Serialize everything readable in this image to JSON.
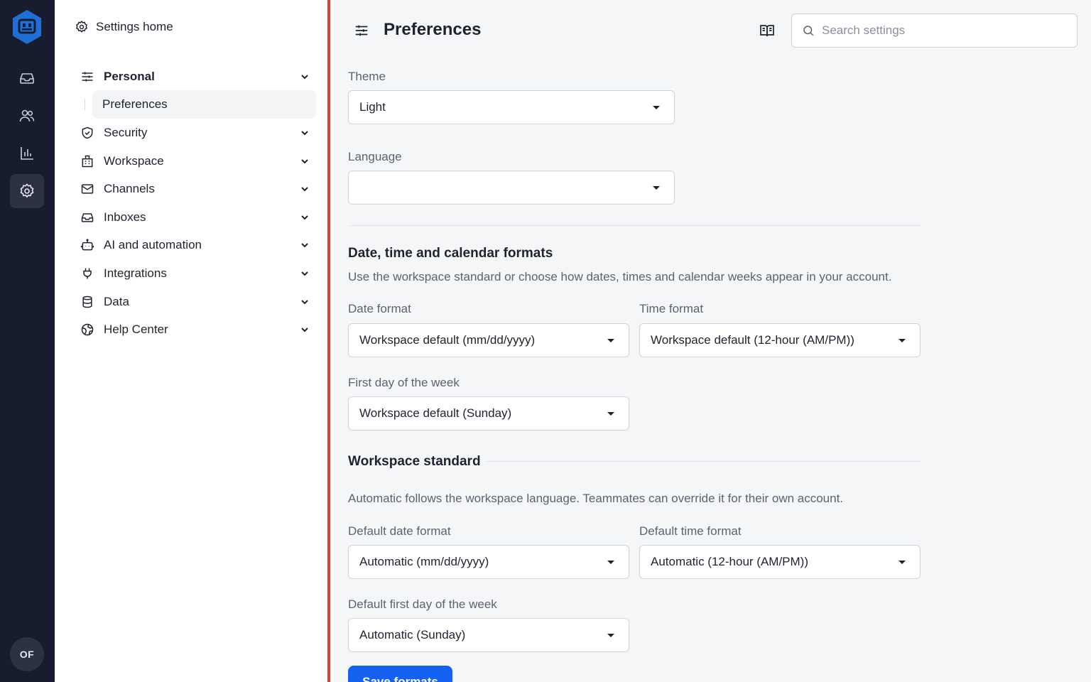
{
  "rail": {
    "items": [
      "inbox-icon",
      "contacts-icon",
      "reports-icon",
      "settings-icon"
    ],
    "avatar_initials": "OF",
    "accent": "#1f6fd6"
  },
  "nav": {
    "home_label": "Settings home",
    "items": [
      {
        "label": "Personal",
        "icon": "sliders-icon",
        "expanded": true
      },
      {
        "label": "Security",
        "icon": "shield-icon"
      },
      {
        "label": "Workspace",
        "icon": "building-icon"
      },
      {
        "label": "Channels",
        "icon": "mail-icon"
      },
      {
        "label": "Inboxes",
        "icon": "inbox-icon"
      },
      {
        "label": "AI and automation",
        "icon": "robot-icon"
      },
      {
        "label": "Integrations",
        "icon": "plug-icon"
      },
      {
        "label": "Data",
        "icon": "database-icon"
      },
      {
        "label": "Help Center",
        "icon": "globe-icon"
      }
    ],
    "subitem": "Preferences"
  },
  "header": {
    "title": "Preferences",
    "search_placeholder": "Search settings"
  },
  "theme": {
    "label": "Theme",
    "value": "Light"
  },
  "language": {
    "label": "Language",
    "value": ""
  },
  "formats": {
    "title": "Date, time and calendar formats",
    "description": "Use the workspace standard or choose how dates, times and calendar weeks appear in your account.",
    "date_label": "Date format",
    "date_value": "Workspace default (mm/dd/yyyy)",
    "time_label": "Time format",
    "time_value": "Workspace default (12-hour (AM/PM))",
    "week_label": "First day of the week",
    "week_value": "Workspace default (Sunday)"
  },
  "standard": {
    "title": "Workspace standard",
    "description": "Automatic follows the workspace language. Teammates can override it for their own account.",
    "date_label": "Default date format",
    "date_value": "Automatic (mm/dd/yyyy)",
    "time_label": "Default time format",
    "time_value": "Automatic (12-hour (AM/PM))",
    "week_label": "Default first day of the week",
    "week_value": "Automatic (Sunday)"
  },
  "save_label": "Save formats"
}
